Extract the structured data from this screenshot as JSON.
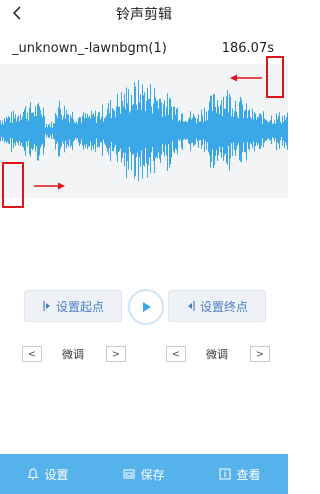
{
  "header": {
    "title": "铃声剪辑",
    "back_icon": "chevron-left-icon"
  },
  "file": {
    "name": "_unknown_-lawnbgm(1)",
    "duration": "186.07s"
  },
  "waveform": {
    "color": "#3aa8e6",
    "background": "#f3f4f6"
  },
  "annotations": {
    "color": "#e0141c"
  },
  "controls": {
    "set_start_label": "设置起点",
    "set_end_label": "设置终点",
    "play_icon": "play-icon",
    "start_icon": "start-marker-icon",
    "end_icon": "end-marker-icon"
  },
  "fine_tune": {
    "left": {
      "label": "微调",
      "prev": "<",
      "next": ">"
    },
    "right": {
      "label": "微调",
      "prev": "<",
      "next": ">"
    }
  },
  "bottom_bar": {
    "background": "#55b2eb",
    "items": [
      {
        "label": "设置",
        "icon": "bell-icon"
      },
      {
        "label": "保存",
        "icon": "save-icon"
      },
      {
        "label": "查看",
        "icon": "view-icon"
      }
    ]
  }
}
